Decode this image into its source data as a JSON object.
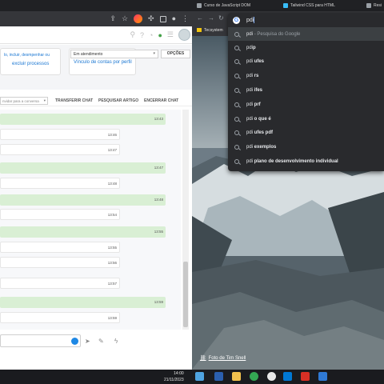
{
  "left_window": {
    "app_cards": {
      "card1_line1": "lo, incluir, desmpenhar ou",
      "card1_line2": "excluir processos",
      "card2_line": "Vínculo de contas por perfil"
    },
    "status_select": "Em atendimento",
    "options_button": "OPÇÕES",
    "invite_placeholder": "nvidar para a conversa",
    "actions": {
      "transfer": "TRANSFERIR CHAT",
      "search_article": "PESQUISAR ARTIGO",
      "close_chat": "ENCERRAR CHAT"
    },
    "messages": [
      {
        "dir": "out",
        "time": "13:43"
      },
      {
        "dir": "in",
        "time": "13:46"
      },
      {
        "dir": "in",
        "time": "13:47"
      },
      {
        "dir": "out",
        "time": "13:47"
      },
      {
        "dir": "in",
        "time": "13:48"
      },
      {
        "dir": "out",
        "time": "13:48"
      },
      {
        "dir": "in",
        "time": "13:54"
      },
      {
        "dir": "out",
        "time": "13:55"
      },
      {
        "dir": "in",
        "time": "13:55"
      },
      {
        "dir": "in",
        "time": "13:56"
      },
      {
        "dir": "in",
        "time": "13:57"
      },
      {
        "dir": "out",
        "time": "13:59"
      },
      {
        "dir": "in",
        "time": "13:59"
      }
    ]
  },
  "taskbar": {
    "time": "14:00",
    "date": "21/11/2023"
  },
  "right_window": {
    "tabs": [
      {
        "label": "Curso de JavaScript DOM",
        "color": "#9aa0a6"
      },
      {
        "label": "Tailwind CSS para HTML",
        "color": "#38bdf8"
      },
      {
        "label": "Resi",
        "color": "#9aa0a6"
      }
    ],
    "bookmark": "Tecsystem",
    "photo_credit": "Foto de Tim Snell",
    "omnibox": {
      "query": "pdi",
      "first_row_query": "pdi",
      "first_row_hint": "Pesquisa do Google",
      "suggestions": [
        {
          "base": "pdi",
          "bold": "p"
        },
        {
          "base": "pdi",
          "bold": " ufes"
        },
        {
          "base": "pdi",
          "bold": " rs"
        },
        {
          "base": "pdi",
          "bold": " ifes"
        },
        {
          "base": "pdi",
          "bold": " prf"
        },
        {
          "base": "pdi",
          "bold": " o que é"
        },
        {
          "base": "pdi",
          "bold": " ufes pdf"
        },
        {
          "base": "pdi",
          "bold": " exemplos"
        },
        {
          "base": "pdi",
          "bold": " plano de desenvolvimento individual"
        }
      ]
    }
  }
}
